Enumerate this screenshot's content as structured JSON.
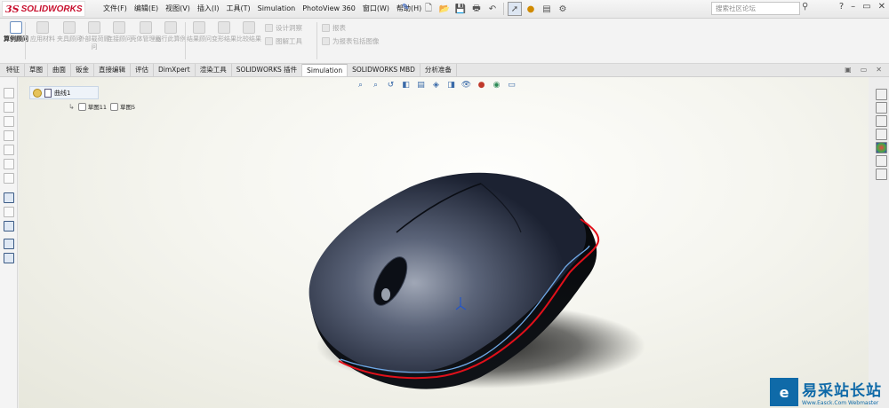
{
  "app": {
    "brand_ds": "3S",
    "brand": "SOLIDWORKS"
  },
  "menu": [
    "文件(F)",
    "编辑(E)",
    "视图(V)",
    "插入(I)",
    "工具(T)",
    "Simulation",
    "PhotoView 360",
    "窗口(W)",
    "帮助(H)"
  ],
  "search": {
    "placeholder": "搜索社区论坛"
  },
  "ribbon": {
    "buttons": [
      {
        "label": "算例顾问",
        "active": true
      },
      {
        "label": "应用材料",
        "active": false
      },
      {
        "label": "夹具顾问",
        "active": false
      },
      {
        "label": "外部载荷顾问",
        "active": false
      },
      {
        "label": "连接顾问",
        "active": false
      },
      {
        "label": "壳体管理器",
        "active": false
      },
      {
        "label": "运行此算例",
        "active": false
      },
      {
        "label": "结果顾问",
        "active": false
      },
      {
        "label": "变形结果",
        "active": false
      },
      {
        "label": "比较结果",
        "active": false
      }
    ],
    "small": [
      {
        "label": "设计洞察"
      },
      {
        "label": "图解工具"
      },
      {
        "label": "报表"
      },
      {
        "label": "为报表包括图像"
      }
    ]
  },
  "tabs": [
    {
      "label": "特征",
      "active": false
    },
    {
      "label": "草图",
      "active": false
    },
    {
      "label": "曲面",
      "active": false
    },
    {
      "label": "钣金",
      "active": false
    },
    {
      "label": "直接编辑",
      "active": false
    },
    {
      "label": "评估",
      "active": false
    },
    {
      "label": "DimXpert",
      "active": false
    },
    {
      "label": "渲染工具",
      "active": false
    },
    {
      "label": "SOLIDWORKS 插件",
      "active": false
    },
    {
      "label": "Simulation",
      "active": true
    },
    {
      "label": "SOLIDWORKS MBD",
      "active": false
    },
    {
      "label": "分析准备",
      "active": false
    }
  ],
  "tree": {
    "root": "曲线1",
    "sketches": [
      "草图11",
      "草图5"
    ]
  },
  "watermark": {
    "cn": "易采站长站",
    "en": "Www.Easck.Com Webmaster",
    "logo": "e"
  },
  "colors": {
    "brand_red": "#c8102e",
    "profile_red": "#e1101a",
    "profile_blue": "#6ea8e6",
    "mouse_body": "#1e2536"
  }
}
